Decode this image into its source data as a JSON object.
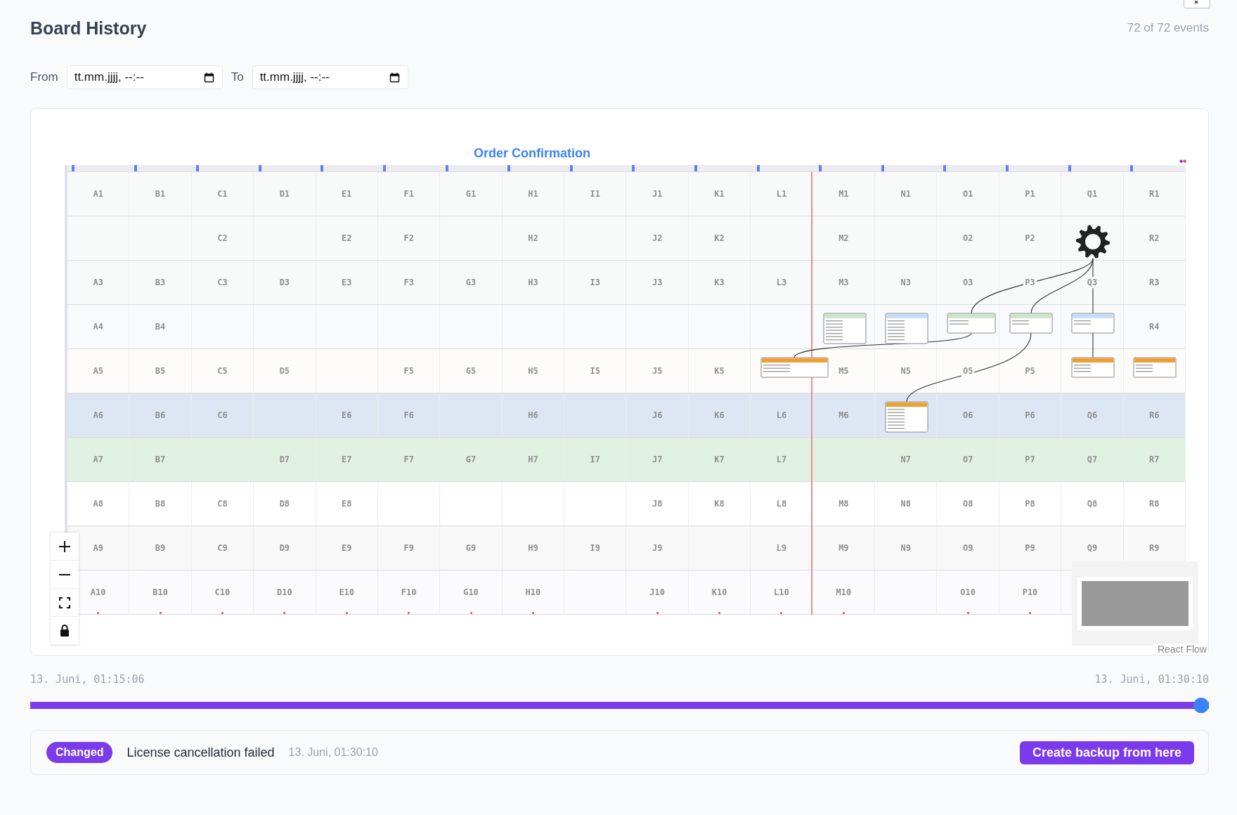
{
  "window": {
    "title": "Board History",
    "event_count": "72 of 72 events"
  },
  "filters": [
    {
      "label": "From",
      "placeholder": "tt.mm.jjjj, --:--"
    },
    {
      "label": "To",
      "placeholder": "tt.mm.jjjj, --:--"
    }
  ],
  "board": {
    "title": "Order Confirmation",
    "attribution": "React Flow",
    "rows": [
      {
        "color": "#f8faf9",
        "cells": [
          "A1",
          "B1",
          "C1",
          "D1",
          "E1",
          "F1",
          "G1",
          "H1",
          "I1",
          "J1",
          "K1",
          "L1",
          "M1",
          "N1",
          "O1",
          "P1",
          "Q1",
          "R1"
        ]
      },
      {
        "color": "#f8faf9",
        "cells": [
          null,
          null,
          "C2",
          null,
          "E2",
          "F2",
          null,
          "H2",
          null,
          "J2",
          "K2",
          null,
          "M2",
          null,
          "O2",
          "P2",
          null,
          "R2"
        ]
      },
      {
        "color": "#f8faf9",
        "cells": [
          "A3",
          "B3",
          "C3",
          "D3",
          "E3",
          "F3",
          "G3",
          "H3",
          "I3",
          "J3",
          "K3",
          "L3",
          "M3",
          "N3",
          "O3",
          "P3",
          "Q3",
          "R3"
        ]
      },
      {
        "color": "#f8fafe",
        "cells": [
          "A4",
          "B4",
          null,
          null,
          null,
          null,
          null,
          null,
          null,
          null,
          null,
          null,
          null,
          null,
          null,
          null,
          null,
          "R4"
        ]
      },
      {
        "color": "#fdfcfa",
        "cells": [
          "A5",
          "B5",
          "C5",
          "D5",
          null,
          "F5",
          "G5",
          "H5",
          "I5",
          "J5",
          "K5",
          null,
          "M5",
          "N5",
          "O5",
          "P5",
          null,
          null
        ]
      },
      {
        "color": "#dde7f3",
        "cells": [
          "A6",
          "B6",
          "C6",
          null,
          "E6",
          "F6",
          null,
          "H6",
          null,
          "J6",
          "K6",
          "L6",
          "M6",
          null,
          "O6",
          "P6",
          "Q6",
          "R6"
        ]
      },
      {
        "color": "#e0f1e1",
        "cells": [
          "A7",
          "B7",
          null,
          "D7",
          "E7",
          "F7",
          "G7",
          "H7",
          "I7",
          "J7",
          "K7",
          "L7",
          null,
          "N7",
          "O7",
          "P7",
          "Q7",
          "R7"
        ]
      },
      {
        "color": "#ffffff",
        "cells": [
          "A8",
          "B8",
          "C8",
          "D8",
          "E8",
          null,
          null,
          null,
          null,
          "J8",
          "K8",
          "L8",
          "M8",
          "N8",
          "O8",
          "P8",
          "Q8",
          "R8"
        ]
      },
      {
        "color": "#f8f8f8",
        "cells": [
          "A9",
          "B9",
          "C9",
          "D9",
          "E9",
          "F9",
          "G9",
          "H9",
          "I9",
          "J9",
          null,
          "L9",
          "M9",
          "N9",
          "O9",
          "P9",
          "Q9",
          "R9"
        ]
      },
      {
        "color": "#fbfafd",
        "cells": [
          "A10",
          "B10",
          "C10",
          "D10",
          "E10",
          "F10",
          "G10",
          "H10",
          null,
          "J10",
          "K10",
          "L10",
          "M10",
          null,
          "O10",
          "P10",
          null,
          null
        ]
      }
    ],
    "nodes": [
      {
        "color": "#cde5c9"
      },
      {
        "color": "#c8def6"
      },
      {
        "color": "#cde5c9"
      },
      {
        "color": "#cde5c9"
      },
      {
        "color": "#c8def6"
      },
      {
        "color": "#f0a030"
      },
      {
        "color": "#f0a030"
      },
      {
        "color": "#f0a030"
      },
      {
        "color": "#f0a030"
      }
    ]
  },
  "timeline": {
    "start": "13. Juni, 01:15:06",
    "end": "13. Juni, 01:30:10",
    "level": 1
  },
  "event": {
    "badge": "Changed",
    "description": "License cancellation failed",
    "time": "13. Juni, 01:30:10",
    "action": "Create backup from here"
  }
}
